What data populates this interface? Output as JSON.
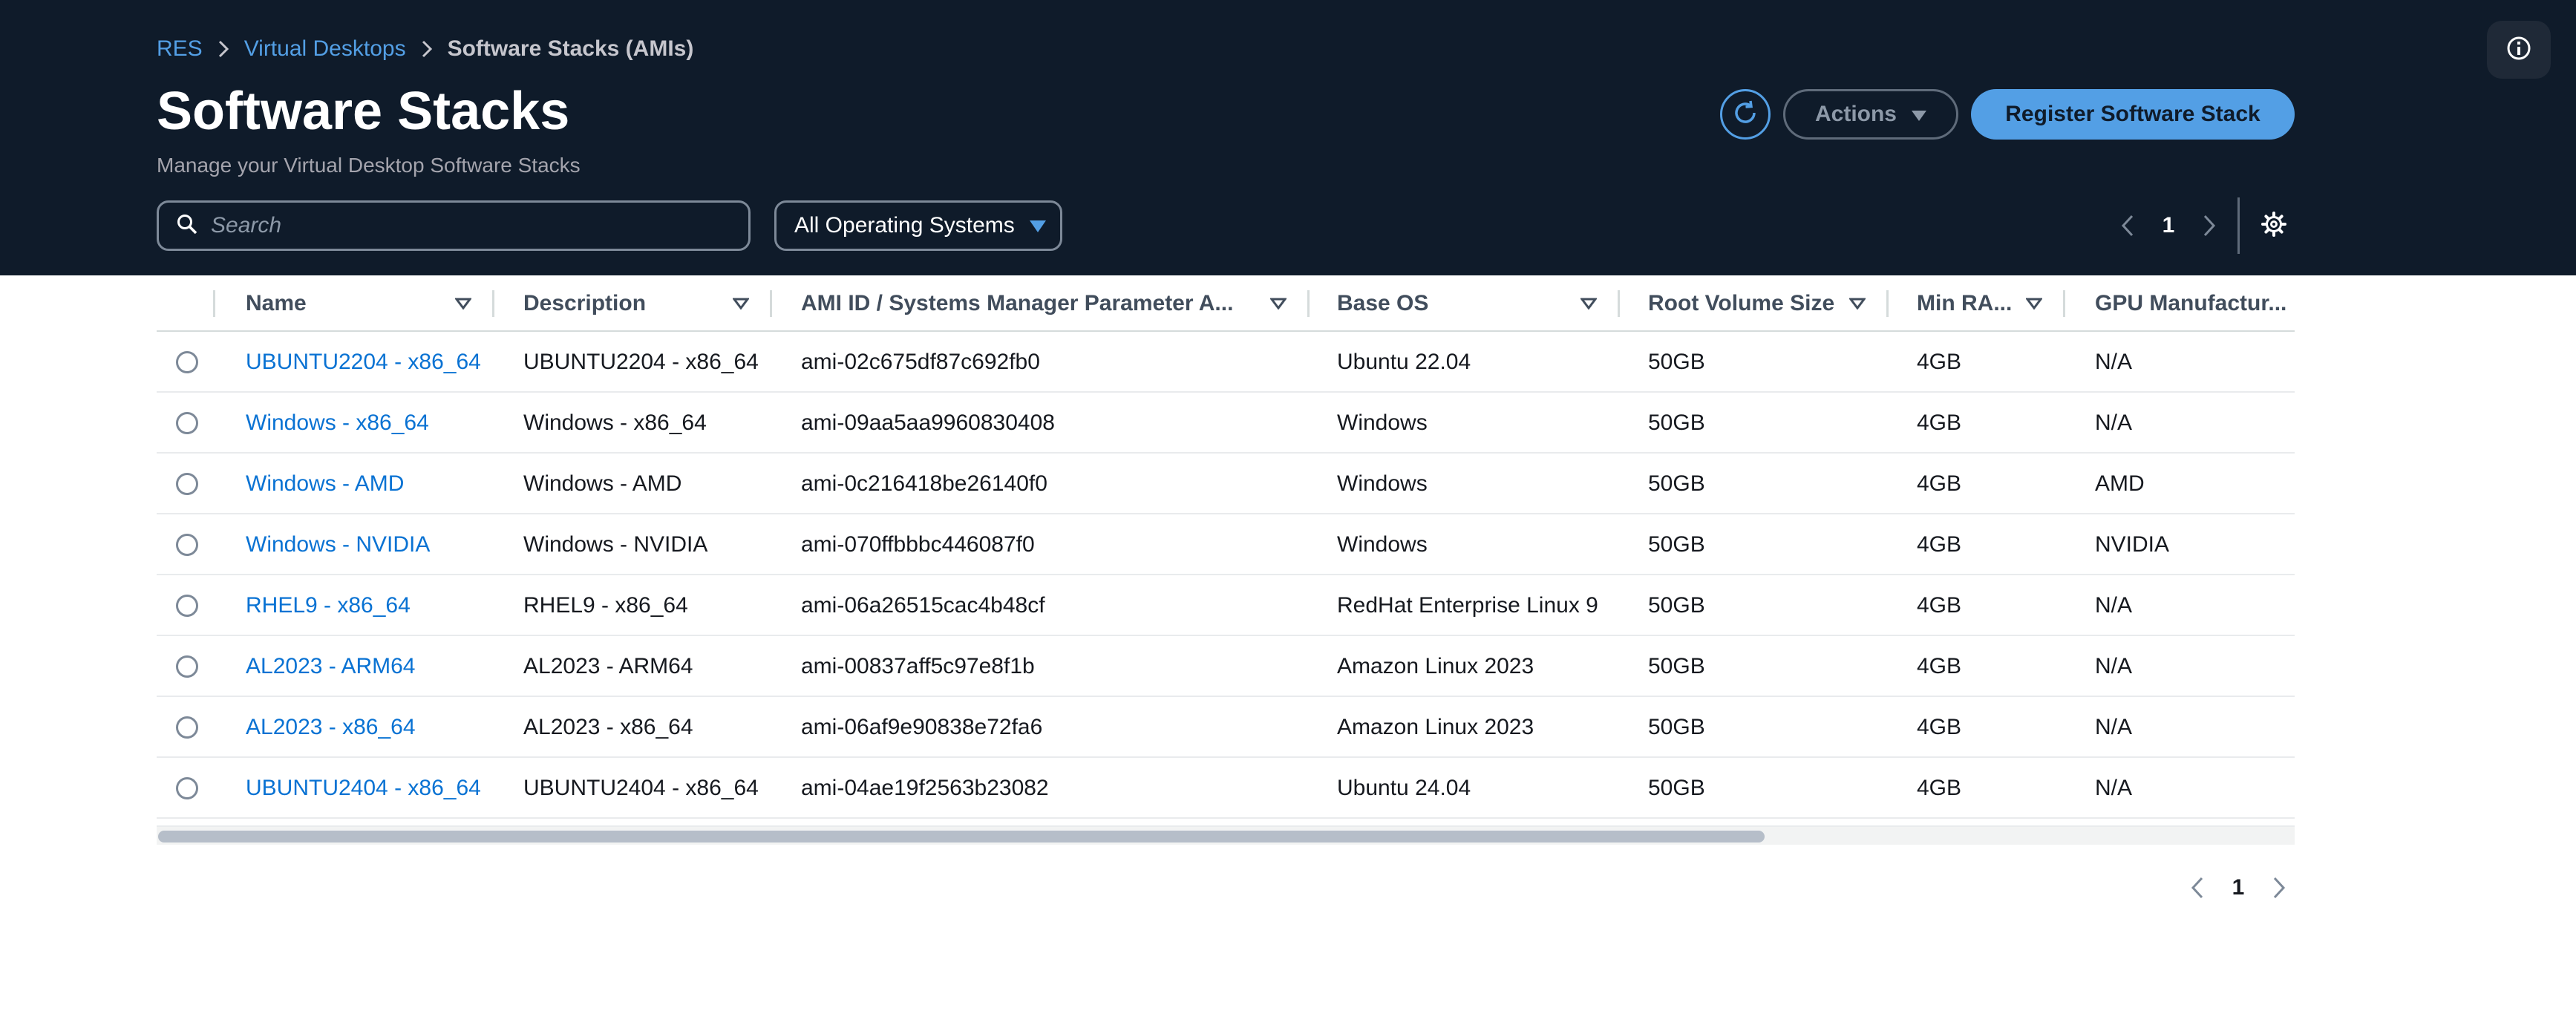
{
  "breadcrumb": {
    "items": [
      "RES",
      "Virtual Desktops"
    ],
    "current": "Software Stacks (AMIs)"
  },
  "header": {
    "title": "Software Stacks",
    "subtitle": "Manage your Virtual Desktop Software Stacks"
  },
  "toolbar": {
    "actions_label": "Actions",
    "register_label": "Register Software Stack"
  },
  "filters": {
    "search_placeholder": "Search",
    "os_filter": "All Operating Systems"
  },
  "pagination": {
    "current_page": "1"
  },
  "table": {
    "columns": [
      "Name",
      "Description",
      "AMI ID / Systems Manager Parameter A...",
      "Base OS",
      "Root Volume Size",
      "Min RA...",
      "GPU Manufactur..."
    ],
    "rows": [
      [
        "UBUNTU2204 - x86_64",
        "UBUNTU2204 - x86_64",
        "ami-02c675df87c692fb0",
        "Ubuntu 22.04",
        "50GB",
        "4GB",
        "N/A"
      ],
      [
        "Windows - x86_64",
        "Windows - x86_64",
        "ami-09aa5aa9960830408",
        "Windows",
        "50GB",
        "4GB",
        "N/A"
      ],
      [
        "Windows - AMD",
        "Windows - AMD",
        "ami-0c216418be26140f0",
        "Windows",
        "50GB",
        "4GB",
        "AMD"
      ],
      [
        "Windows - NVIDIA",
        "Windows - NVIDIA",
        "ami-070ffbbbc446087f0",
        "Windows",
        "50GB",
        "4GB",
        "NVIDIA"
      ],
      [
        "RHEL9 - x86_64",
        "RHEL9 - x86_64",
        "ami-06a26515cac4b48cf",
        "RedHat Enterprise Linux 9",
        "50GB",
        "4GB",
        "N/A"
      ],
      [
        "AL2023 - ARM64",
        "AL2023 - ARM64",
        "ami-00837aff5c97e8f1b",
        "Amazon Linux 2023",
        "50GB",
        "4GB",
        "N/A"
      ],
      [
        "AL2023 - x86_64",
        "AL2023 - x86_64",
        "ami-06af9e90838e72fa6",
        "Amazon Linux 2023",
        "50GB",
        "4GB",
        "N/A"
      ],
      [
        "UBUNTU2404 - x86_64",
        "UBUNTU2404 - x86_64",
        "ami-04ae19f2563b23082",
        "Ubuntu 24.04",
        "50GB",
        "4GB",
        "N/A"
      ]
    ]
  },
  "icons": {
    "info": "info-icon",
    "refresh": "refresh-icon",
    "search": "search-icon",
    "settings": "gear-icon",
    "sort": "caret-down-icon",
    "page_prev": "chevron-left-icon",
    "page_next": "chevron-right-icon"
  },
  "colors": {
    "header_bg": "#0f1b2a",
    "accent": "#539fe5",
    "link": "#0972d3"
  }
}
